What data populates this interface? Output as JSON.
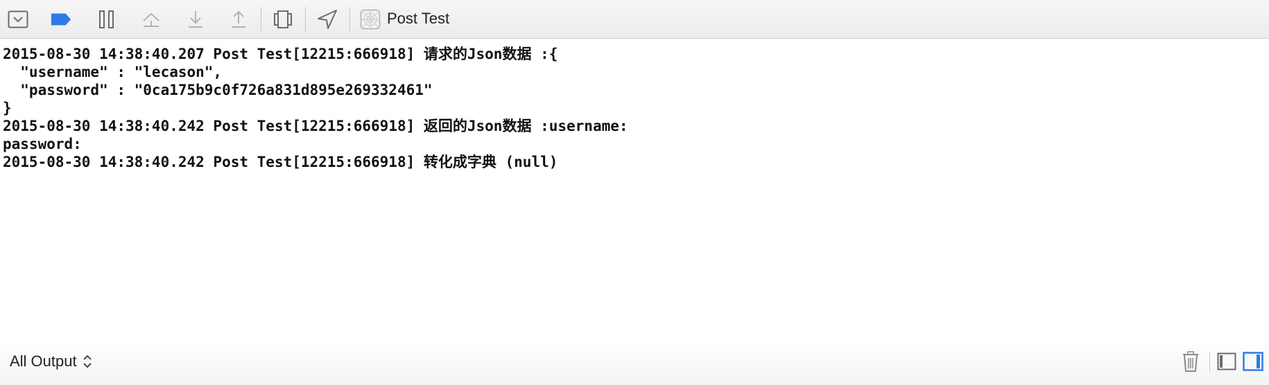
{
  "toolbar": {
    "target_name": "Post Test",
    "icons": [
      "hide-debug-area-icon",
      "breakpoints-toggle-icon",
      "pause-icon",
      "step-over-icon",
      "step-into-icon",
      "step-out-icon",
      "debug-view-hierarchy-icon",
      "simulate-location-icon",
      "app-target-icon"
    ],
    "accent_color": "#2f7be5"
  },
  "console": {
    "lines": [
      "2015-08-30 14:38:40.207 Post Test[12215:666918] 请求的Json数据 :{",
      "  \"username\" : \"lecason\",",
      "  \"password\" : \"0ca175b9c0f726a831d895e269332461\"",
      "}",
      "2015-08-30 14:38:40.242 Post Test[12215:666918] 返回的Json数据 :username:",
      "password:",
      "2015-08-30 14:38:40.242 Post Test[12215:666918] 转化成字典 (null)"
    ]
  },
  "bottombar": {
    "filter_label": "All Output",
    "icons": [
      "trash-icon",
      "show-variables-view-icon",
      "show-console-view-icon"
    ]
  }
}
